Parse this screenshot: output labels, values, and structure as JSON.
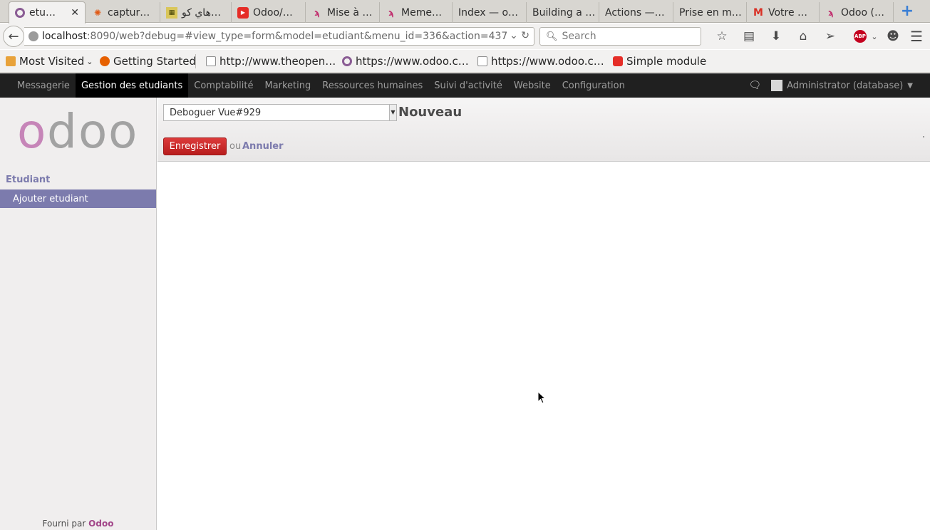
{
  "browser": {
    "tabs": [
      {
        "label": "etu…",
        "icon": "odoo-ring-icon",
        "active": true
      },
      {
        "label": "captur…",
        "icon": "ubuntu-icon"
      },
      {
        "label": "هاي كو…",
        "icon": "arabic-site-icon"
      },
      {
        "label": "Odoo/…",
        "icon": "youtube-icon"
      },
      {
        "label": "Mise à …",
        "icon": "openerp-icon"
      },
      {
        "label": "Meme…",
        "icon": "openerp-icon"
      },
      {
        "label": "Index — o…",
        "icon": ""
      },
      {
        "label": "Building a …",
        "icon": ""
      },
      {
        "label": "Actions —…",
        "icon": ""
      },
      {
        "label": "Prise en m…",
        "icon": ""
      },
      {
        "label": "Votre …",
        "icon": "gmail-icon"
      },
      {
        "label": "Odoo (…",
        "icon": "openerp-icon"
      }
    ],
    "url_host": "localhost",
    "url_rest": ":8090/web?debug=#view_type=form&model=etudiant&menu_id=336&action=437",
    "search_placeholder": "Search",
    "bookmarks": [
      {
        "label": "Most Visited",
        "icon": "folder"
      },
      {
        "label": "Getting Started",
        "icon": "fox"
      },
      {
        "label": "http://www.theopen…",
        "icon": "box"
      },
      {
        "label": "https://www.odoo.c…",
        "icon": "ring"
      },
      {
        "label": "https://www.odoo.c…",
        "icon": "box"
      },
      {
        "label": "Simple module",
        "icon": "yt"
      }
    ],
    "abp_label": "ABP"
  },
  "odoo": {
    "top_menu": [
      {
        "label": "Messagerie"
      },
      {
        "label": "Gestion des etudiants",
        "active": true
      },
      {
        "label": "Comptabilité"
      },
      {
        "label": "Marketing"
      },
      {
        "label": "Ressources humaines"
      },
      {
        "label": "Suivi d'activité"
      },
      {
        "label": "Website"
      },
      {
        "label": "Configuration"
      }
    ],
    "user": "Administrator (database)",
    "logo_text": "odoo",
    "sidebar": {
      "section_title": "Etudiant",
      "active_item": "Ajouter etudiant",
      "powered_by_prefix": "Fourni par",
      "powered_by_brand": "Odoo"
    },
    "control_panel": {
      "debug_select": "Deboguer Vue#929",
      "breadcrumb": "Nouveau",
      "save_label": "Enregistrer",
      "or_label": "ou",
      "cancel_label": "Annuler"
    }
  },
  "colors": {
    "brand": "#7c7bad",
    "save": "#d3212a",
    "logo_pink": "#c685b8",
    "logo_grey": "#a2a2a2"
  }
}
